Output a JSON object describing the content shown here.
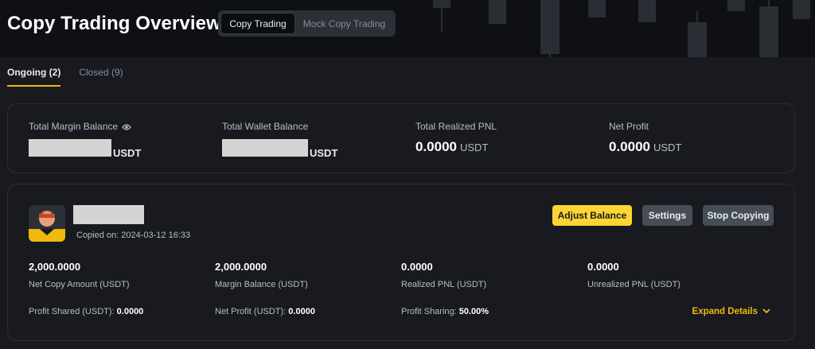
{
  "header": {
    "title": "Copy Trading Overview",
    "modes": [
      {
        "label": "Copy Trading",
        "active": true
      },
      {
        "label": "Mock Copy Trading",
        "active": false
      }
    ]
  },
  "tabs": [
    {
      "label": "Ongoing (2)",
      "active": true
    },
    {
      "label": "Closed (9)",
      "active": false
    }
  ],
  "summary": {
    "total_margin_balance": {
      "label": "Total Margin Balance",
      "value": "",
      "unit": "USDT",
      "masked": true
    },
    "total_wallet_balance": {
      "label": "Total Wallet Balance",
      "value": "",
      "unit": "USDT",
      "masked": true
    },
    "total_realized_pnl": {
      "label": "Total Realized PNL",
      "value": "0.0000",
      "unit": "USDT"
    },
    "net_profit": {
      "label": "Net Profit",
      "value": "0.0000",
      "unit": "USDT"
    }
  },
  "trader": {
    "copied_on": "Copied on: 2024-03-12 16:33",
    "buttons": {
      "adjust_balance": "Adjust Balance",
      "settings": "Settings",
      "stop_copying": "Stop Copying"
    },
    "metrics": [
      {
        "value": "2,000.0000",
        "label": "Net Copy Amount (USDT)"
      },
      {
        "value": "2,000.0000",
        "label": "Margin Balance (USDT)"
      },
      {
        "value": "0.0000",
        "label": "Realized PNL (USDT)"
      },
      {
        "value": "0.0000",
        "label": "Unrealized PNL (USDT)"
      }
    ],
    "sub": {
      "profit_shared_label": "Profit Shared (USDT):",
      "profit_shared_value": "0.0000",
      "net_profit_label": "Net Profit (USDT):",
      "net_profit_value": "0.0000",
      "profit_sharing_label": "Profit Sharing:",
      "profit_sharing_value": "50.00%"
    },
    "expand_label": "Expand Details"
  },
  "colors": {
    "accent": "#f0b90b",
    "primary_button": "#fcd535",
    "background": "#181a20"
  },
  "icons": {
    "eye": "eye-icon",
    "expand": "chevron-down-icon",
    "avatar": "user-avatar"
  }
}
